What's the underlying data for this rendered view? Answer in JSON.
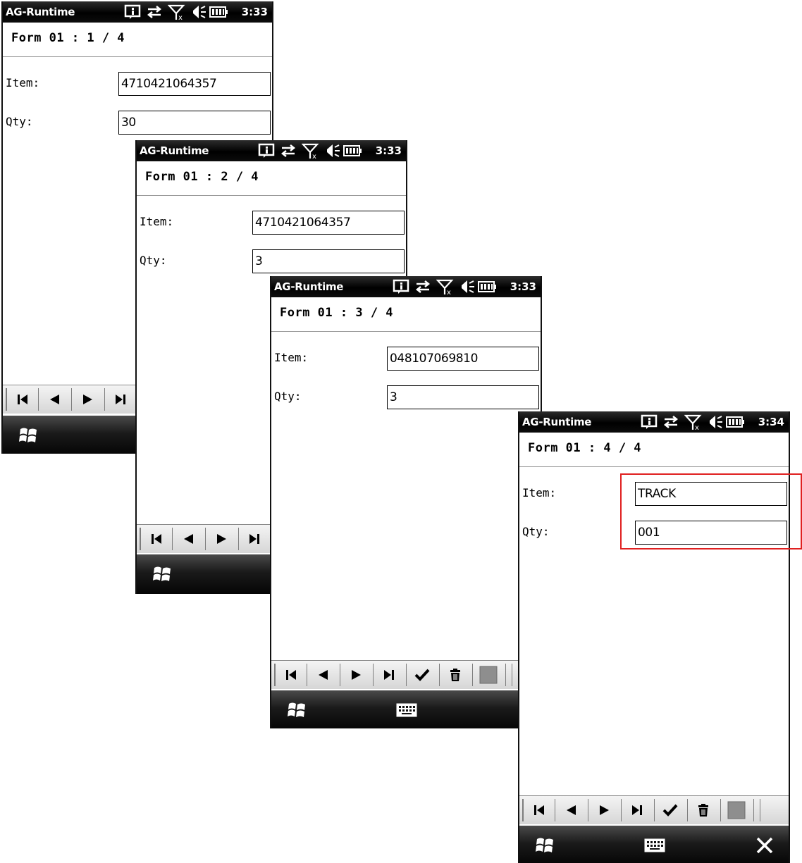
{
  "screens": [
    {
      "app_title": "AG-Runtime",
      "clock": "3:33",
      "form_title": "Form 01 : 1 / 4",
      "item_label": "Item:",
      "item_value": "4710421064357",
      "qty_label": "Qty:",
      "qty_value": "30"
    },
    {
      "app_title": "AG-Runtime",
      "clock": "3:33",
      "form_title": "Form 01 : 2 / 4",
      "item_label": "Item:",
      "item_value": "4710421064357",
      "qty_label": "Qty:",
      "qty_value": "3"
    },
    {
      "app_title": "AG-Runtime",
      "clock": "3:33",
      "form_title": "Form 01 : 3 / 4",
      "item_label": "Item:",
      "item_value": "048107069810",
      "qty_label": "Qty:",
      "qty_value": "3"
    },
    {
      "app_title": "AG-Runtime",
      "clock": "3:34",
      "form_title": "Form 01 : 4 / 4",
      "item_label": "Item:",
      "item_value": "TRACK",
      "qty_label": "Qty:",
      "qty_value": "001"
    }
  ],
  "status_icons": [
    "notification-icon",
    "sync-arrows-icon",
    "no-signal-icon",
    "speaker-muted-icon",
    "battery-icon"
  ],
  "toolbar_icons": [
    "first-record-icon",
    "previous-record-icon",
    "next-record-icon",
    "last-record-icon",
    "confirm-check-icon",
    "delete-trash-icon",
    "gray-square-icon"
  ],
  "softkey_icons": [
    "windows-start-icon",
    "keyboard-icon",
    "close-icon"
  ],
  "colors": {
    "highlight": "#e02020",
    "statusbar": "#000000",
    "toolbar": "#e0e0e0"
  }
}
